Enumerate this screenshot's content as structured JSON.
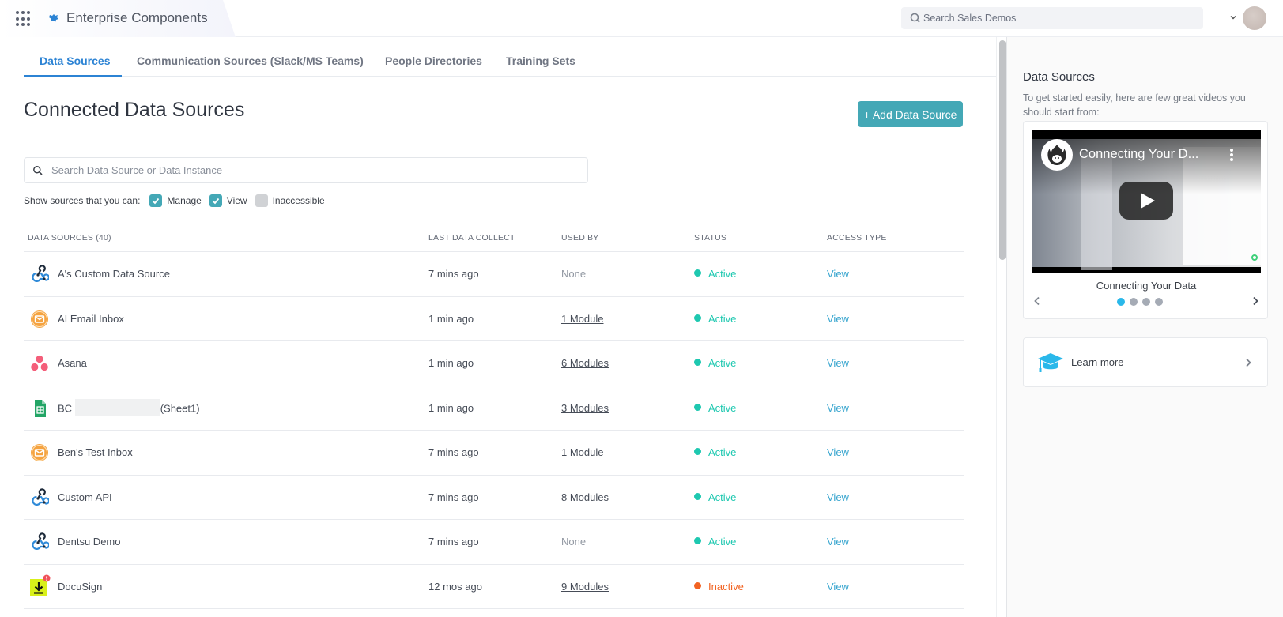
{
  "header": {
    "app_title": "Enterprise Components",
    "search_placeholder": "Search Sales Demos",
    "icons": {
      "apps": "apps-grid-icon",
      "logo": "enterprise-logo-icon",
      "search": "search-icon",
      "user_menu": "chevron-down-icon"
    }
  },
  "tabs": [
    {
      "label": "Data Sources",
      "active": true
    },
    {
      "label": "Communication Sources (Slack/MS Teams)",
      "active": false
    },
    {
      "label": "People Directories",
      "active": false
    },
    {
      "label": "Training Sets",
      "active": false
    }
  ],
  "main": {
    "title": "Connected Data Sources",
    "add_button_label": "+ Add Data Source",
    "search_placeholder": "Search Data Source or Data Instance",
    "filter": {
      "label": "Show sources that you can:",
      "options": [
        {
          "label": "Manage",
          "checked": true
        },
        {
          "label": "View",
          "checked": true
        },
        {
          "label": "Inaccessible",
          "checked": false
        }
      ]
    }
  },
  "table": {
    "columns": [
      "DATA SOURCES (40)",
      "LAST DATA COLLECT",
      "USED BY",
      "STATUS",
      "ACCESS TYPE"
    ],
    "rows": [
      {
        "icon": "webhook-icon",
        "name": "A's Custom Data Source",
        "last_collect": "7 mins ago",
        "used_by": "None",
        "status": "Active",
        "access": "View"
      },
      {
        "icon": "email-icon",
        "name": "AI Email Inbox",
        "last_collect": "1 min ago",
        "used_by": "1 Module",
        "status": "Active",
        "access": "View"
      },
      {
        "icon": "asana-icon",
        "name": "Asana",
        "last_collect": "1 min ago",
        "used_by": "6 Modules",
        "status": "Active",
        "access": "View"
      },
      {
        "icon": "google-sheets-icon",
        "name_prefix": "BC",
        "name": "(Sheet1)",
        "redacted": true,
        "last_collect": "1 min ago",
        "used_by": "3 Modules",
        "status": "Active",
        "access": "View"
      },
      {
        "icon": "email-icon",
        "name": "Ben's Test Inbox",
        "last_collect": "7 mins ago",
        "used_by": "1 Module",
        "status": "Active",
        "access": "View"
      },
      {
        "icon": "webhook-icon",
        "name": "Custom API",
        "last_collect": "7 mins ago",
        "used_by": "8 Modules",
        "status": "Active",
        "access": "View"
      },
      {
        "icon": "webhook-icon",
        "name": "Dentsu Demo",
        "last_collect": "7 mins ago",
        "used_by": "None",
        "status": "Active",
        "access": "View"
      },
      {
        "icon": "download-icon",
        "name": "DocuSign",
        "last_collect": "12 mos ago",
        "used_by": "9 Modules",
        "status": "Inactive",
        "access": "View",
        "warning": true
      }
    ]
  },
  "colors": {
    "accent": "#2c83d4",
    "button": "#44a8b6",
    "active": "#1ec8b0",
    "inactive": "#f26322",
    "link": "#39a6cf"
  },
  "side_panel": {
    "title": "Data Sources",
    "description": "To get started easily, here are few great videos you should start from:",
    "video": {
      "title": "Connecting Your D...",
      "caption": "Connecting Your Data",
      "slide_count": 4,
      "active_slide": 1
    },
    "learn_more_label": "Learn more"
  }
}
